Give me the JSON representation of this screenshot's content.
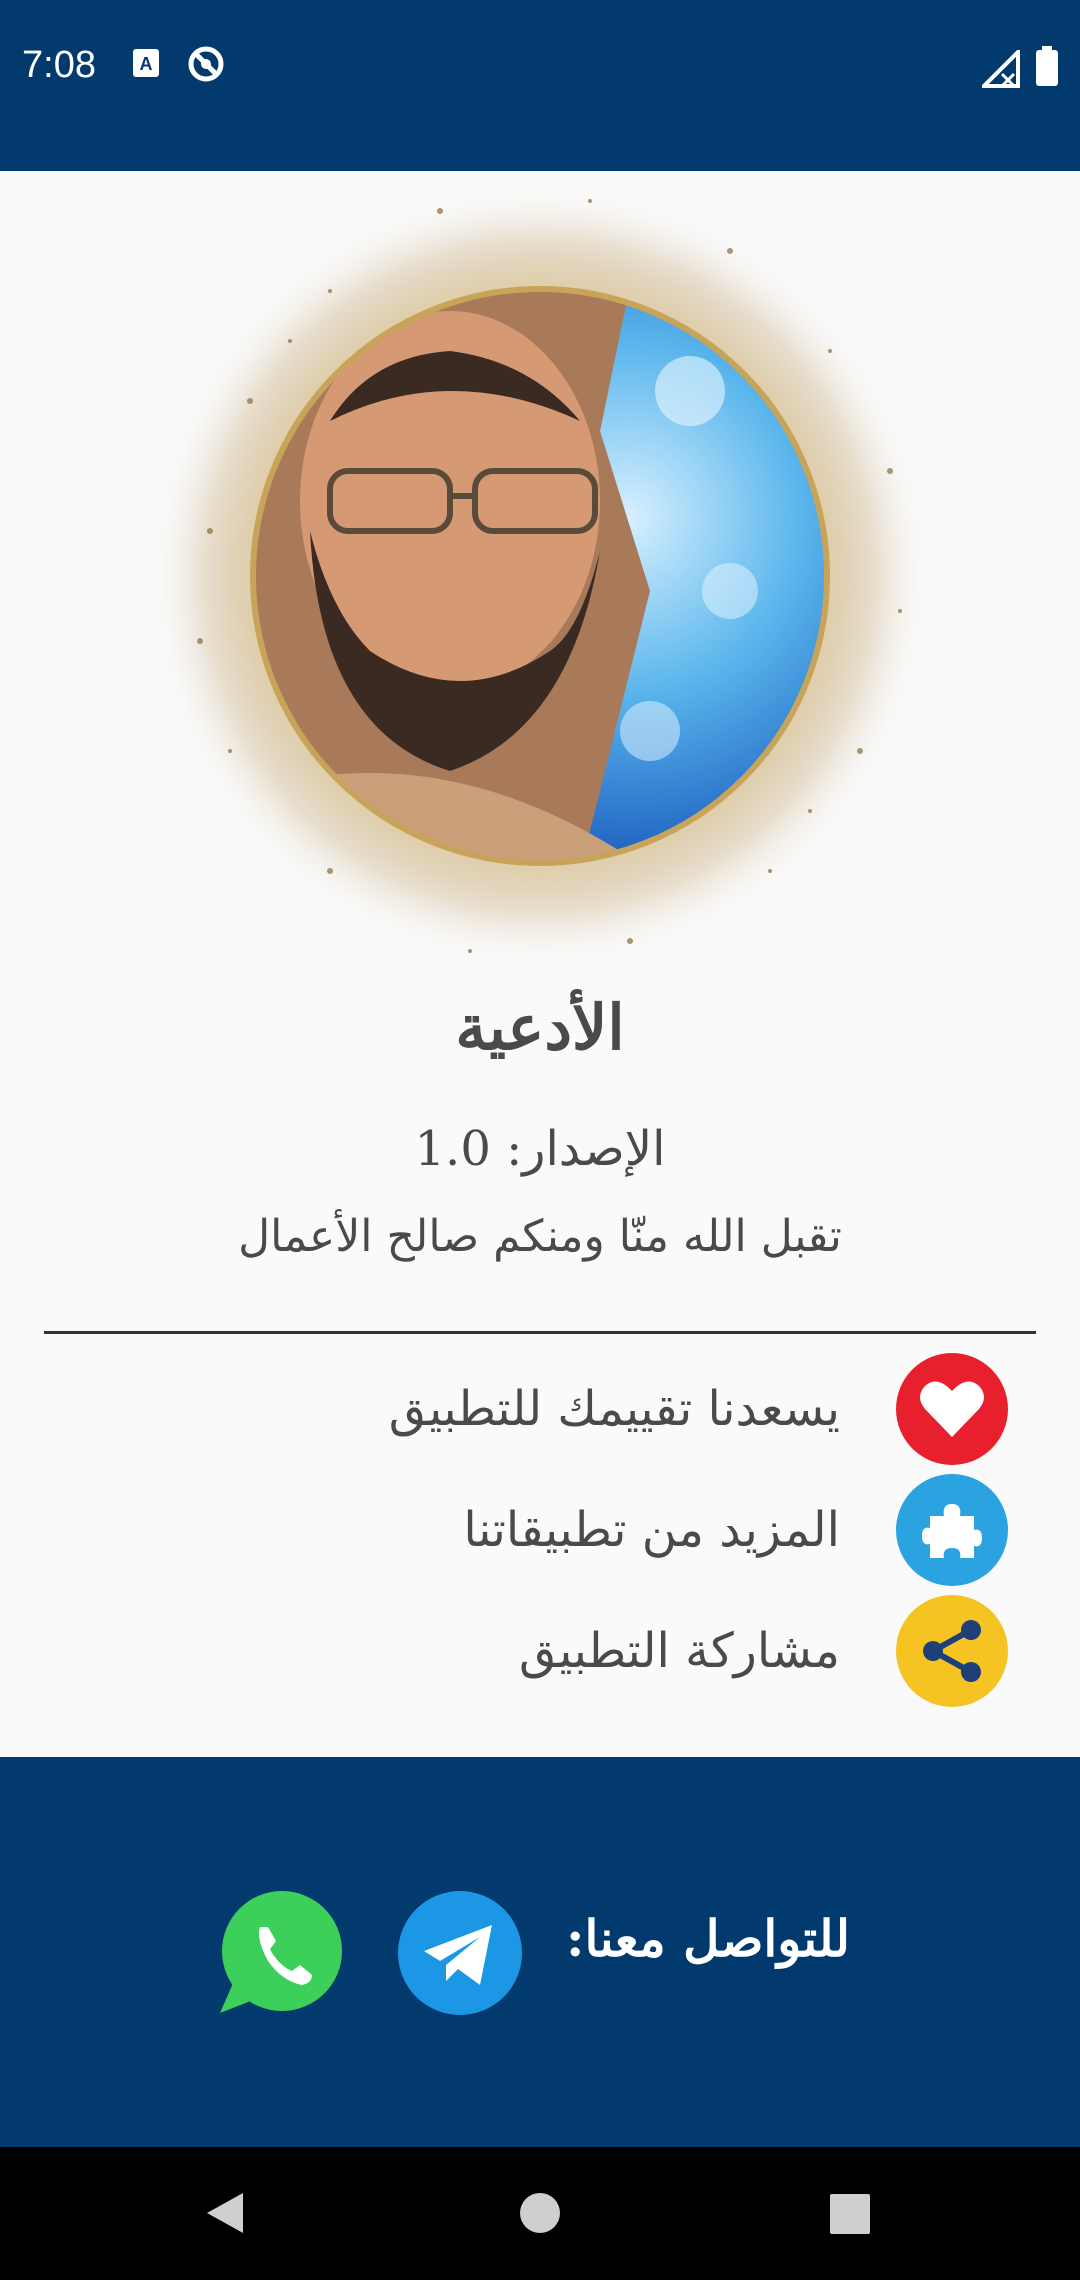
{
  "status_bar": {
    "time": "7:08",
    "icons": [
      "a-badge-icon",
      "no-sync-icon",
      "signal-off-icon",
      "battery-icon"
    ]
  },
  "app": {
    "title": "الأدعية",
    "version": "الإصدار: 1.0",
    "blessing": "تقبل الله منّا ومنكم صالح الأعمال"
  },
  "menu": {
    "items": [
      {
        "label": "يسعدنا تقييمك للتطبيق",
        "icon": "heart-icon",
        "color": "#e8202e"
      },
      {
        "label": "المزيد من تطبيقاتنا",
        "icon": "puzzle-icon",
        "color": "#2ba3e0"
      },
      {
        "label": "مشاركة التطبيق",
        "icon": "share-icon",
        "color": "#f5c423"
      }
    ]
  },
  "footer": {
    "contact_label": "للتواصل معنا:",
    "whatsapp_color": "#3ccf5a",
    "telegram_color": "#1b97e6"
  },
  "colors": {
    "primary": "#033a6e",
    "background": "#fafafa"
  },
  "navigation": {
    "buttons": [
      "back-icon",
      "home-icon",
      "recents-icon"
    ]
  }
}
